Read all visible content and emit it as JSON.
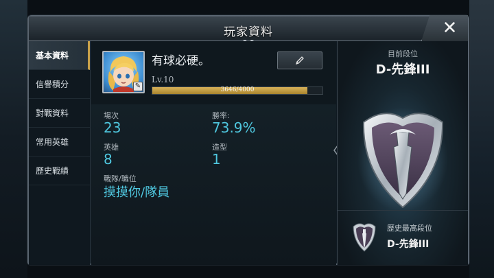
{
  "window": {
    "title": "玩家資料",
    "close_icon": "close-icon"
  },
  "sidebar": {
    "items": [
      {
        "label": "基本資料",
        "active": true
      },
      {
        "label": "信譽積分",
        "active": false
      },
      {
        "label": "對戰資料",
        "active": false
      },
      {
        "label": "常用英雄",
        "active": false
      },
      {
        "label": "歷史戰績",
        "active": false
      }
    ]
  },
  "profile": {
    "name": "有球必硬。",
    "level": "Lv.10",
    "xp_text": "3646/4000",
    "xp_fraction": 0.9115,
    "avatar_icon": "hero-avatar",
    "edit_icon": "pencil-icon"
  },
  "stats": {
    "matches_label": "場次",
    "matches_value": "23",
    "winrate_label": "勝率:",
    "winrate_value": "73.9%",
    "heroes_label": "英雄",
    "heroes_value": "8",
    "skins_label": "造型",
    "skins_value": "1",
    "team_label": "戰隊/職位",
    "team_value": "摸摸你/隊員"
  },
  "rank": {
    "current_caption": "目前段位",
    "current_name": "D-先鋒III",
    "history_caption": "歷史最高段位",
    "history_name": "D-先鋒III"
  },
  "colors": {
    "accent_gold": "#c9a24a",
    "stat_cyan": "#4fc7df"
  }
}
